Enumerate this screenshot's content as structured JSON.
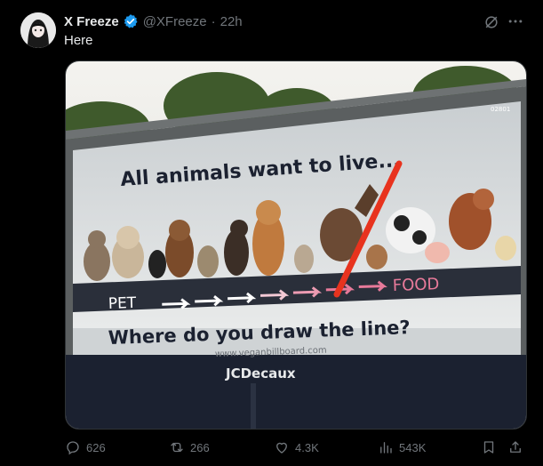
{
  "post": {
    "author_name": "X Freeze",
    "author_handle": "@XFreeze",
    "time_ago": "22h",
    "separator": "·",
    "text": "Here"
  },
  "image": {
    "billboard_headline": "All animals want to live...",
    "label_pet": "PET",
    "label_food": "FOOD",
    "question": "Where do you draw the line?",
    "url": "www.veganbillboard.com",
    "brand": "JCDecaux",
    "panel_id": "02801"
  },
  "actions": {
    "replies": "626",
    "reposts": "266",
    "likes": "4.3K",
    "views": "543K"
  },
  "icons": [
    "verified-badge-icon",
    "grok-icon",
    "more-icon",
    "reply-icon",
    "repost-icon",
    "like-icon",
    "views-icon",
    "bookmark-icon",
    "share-icon"
  ],
  "colors": {
    "background": "#000000",
    "text": "#e7e9ea",
    "muted": "#71767b",
    "verified": "#1d9bf0",
    "line_red": "#e8331e",
    "food_pink": "#e87a9a"
  }
}
